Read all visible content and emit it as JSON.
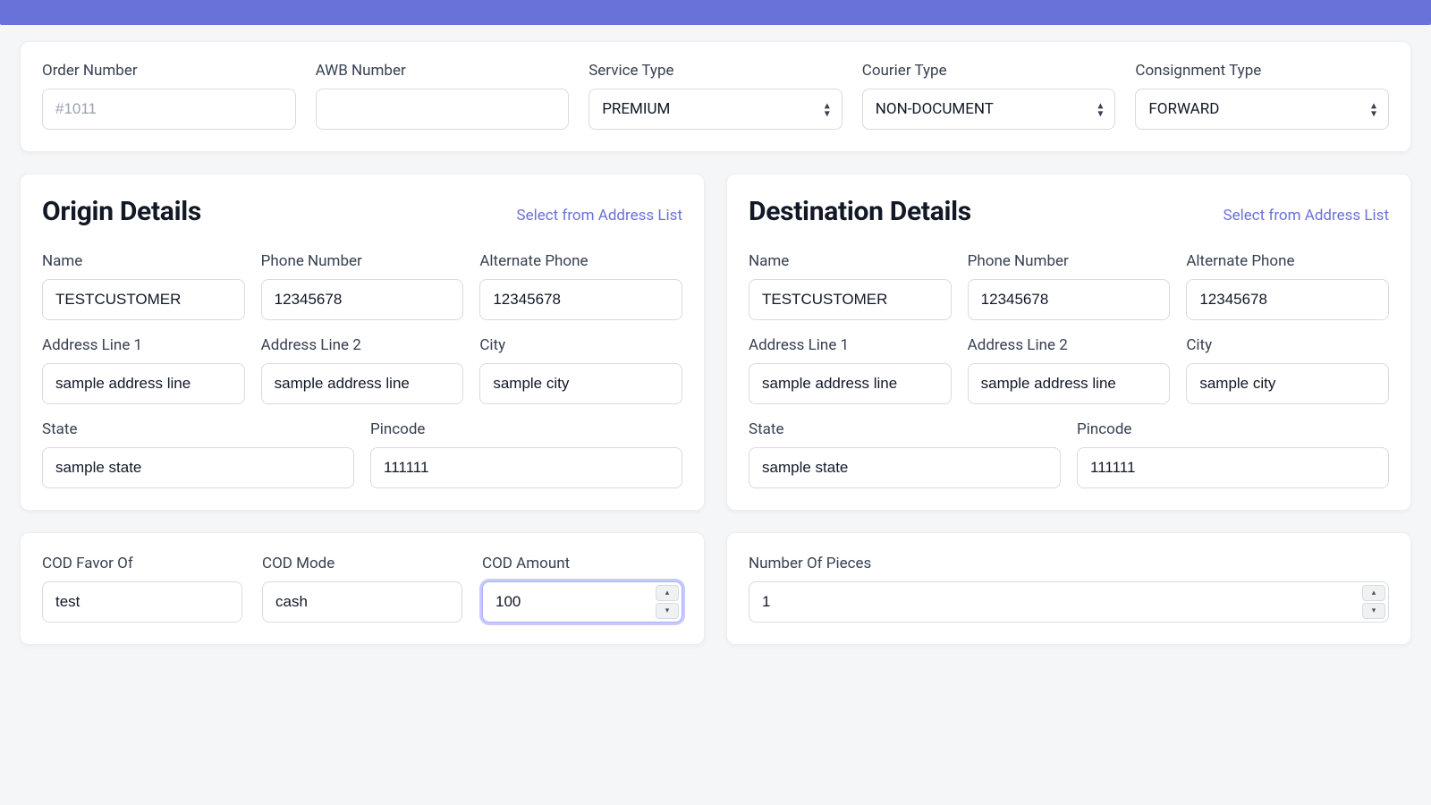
{
  "header": {
    "order_number": {
      "label": "Order Number",
      "placeholder": "#1011",
      "value": ""
    },
    "awb_number": {
      "label": "AWB Number",
      "value": ""
    },
    "service_type": {
      "label": "Service Type",
      "value": "PREMIUM"
    },
    "courier_type": {
      "label": "Courier Type",
      "value": "NON-DOCUMENT"
    },
    "consignment_type": {
      "label": "Consignment Type",
      "value": "FORWARD"
    }
  },
  "origin": {
    "title": "Origin Details",
    "select_link": "Select from Address List",
    "name": {
      "label": "Name",
      "value": "TESTCUSTOMER"
    },
    "phone": {
      "label": "Phone Number",
      "value": "12345678"
    },
    "alt_phone": {
      "label": "Alternate Phone",
      "value": "12345678"
    },
    "addr1": {
      "label": "Address Line 1",
      "value": "sample address line"
    },
    "addr2": {
      "label": "Address Line 2",
      "value": "sample address line"
    },
    "city": {
      "label": "City",
      "value": "sample city"
    },
    "state": {
      "label": "State",
      "value": "sample state"
    },
    "pincode": {
      "label": "Pincode",
      "value": "111111"
    }
  },
  "destination": {
    "title": "Destination Details",
    "select_link": "Select from Address List",
    "name": {
      "label": "Name",
      "value": "TESTCUSTOMER"
    },
    "phone": {
      "label": "Phone Number",
      "value": "12345678"
    },
    "alt_phone": {
      "label": "Alternate Phone",
      "value": "12345678"
    },
    "addr1": {
      "label": "Address Line 1",
      "value": "sample address line"
    },
    "addr2": {
      "label": "Address Line 2",
      "value": "sample address line"
    },
    "city": {
      "label": "City",
      "value": "sample city"
    },
    "state": {
      "label": "State",
      "value": "sample state"
    },
    "pincode": {
      "label": "Pincode",
      "value": "111111"
    }
  },
  "cod": {
    "favor": {
      "label": "COD Favor Of",
      "value": "test"
    },
    "mode": {
      "label": "COD Mode",
      "value": "cash"
    },
    "amount": {
      "label": "COD Amount",
      "value": "100"
    }
  },
  "pieces": {
    "count": {
      "label": "Number Of Pieces",
      "value": "1"
    }
  }
}
